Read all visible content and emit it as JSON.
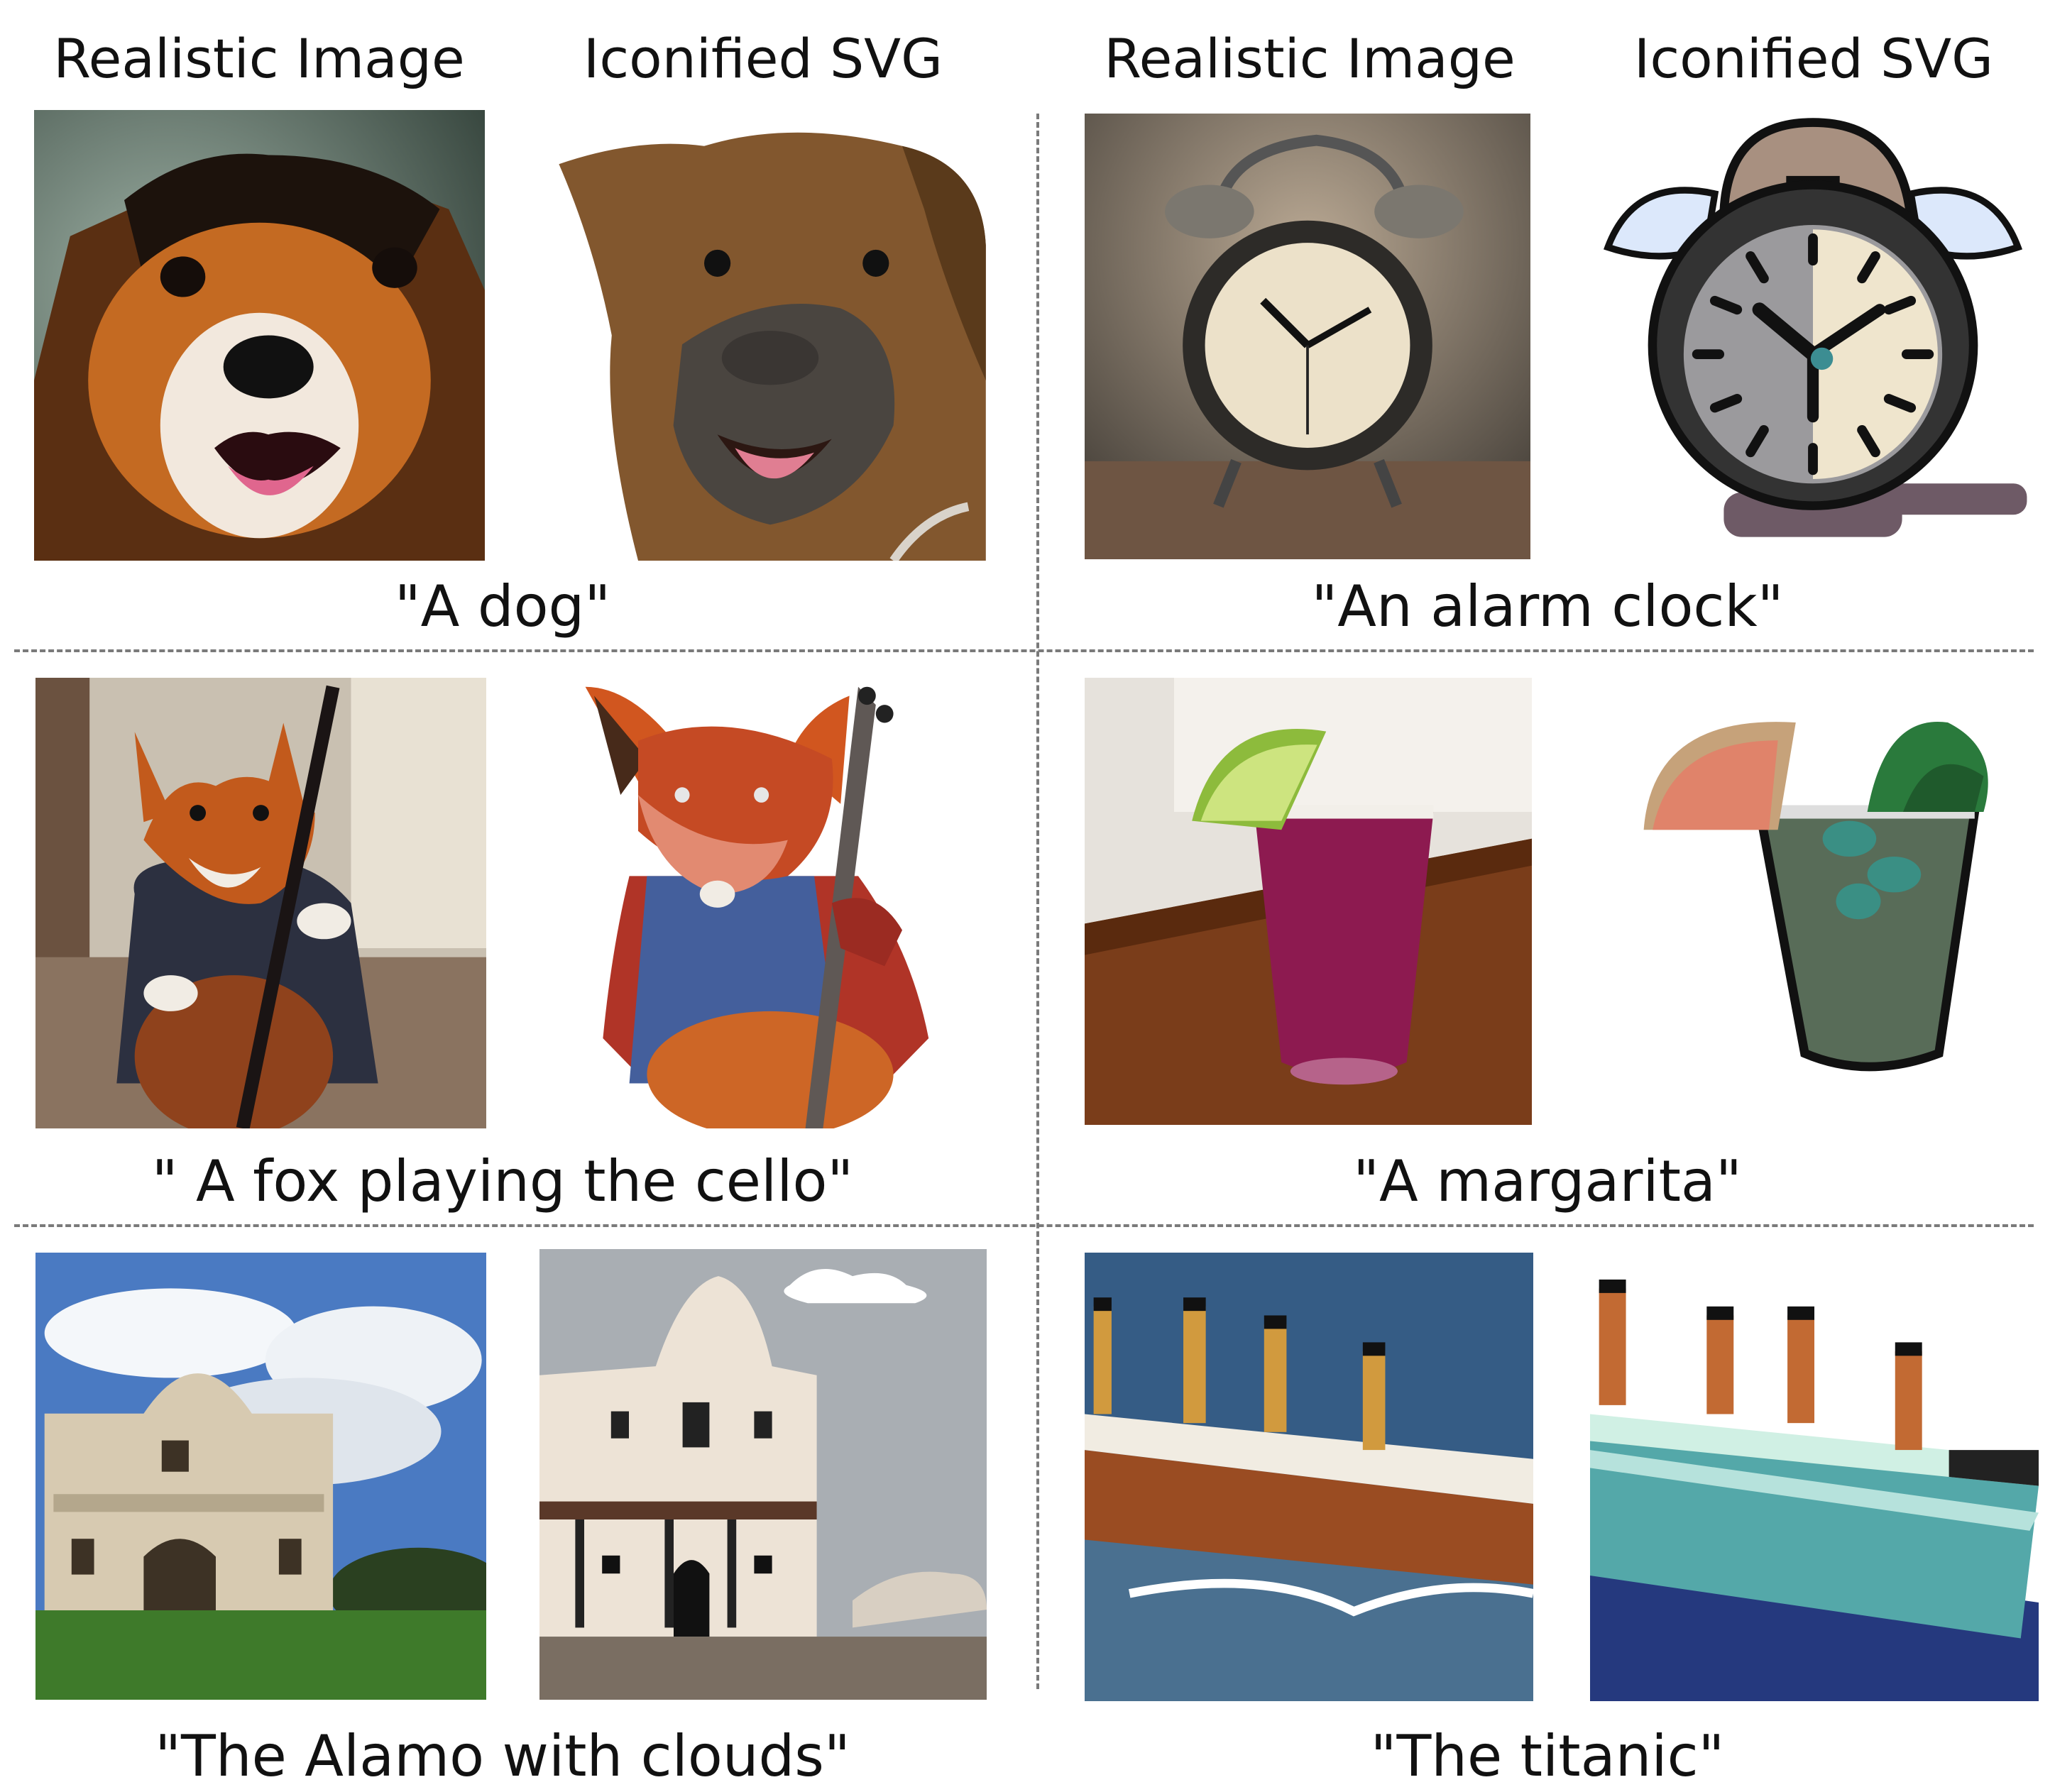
{
  "headers": {
    "left_realistic": "Realistic Image",
    "left_iconified": "Iconified SVG",
    "right_realistic": "Realistic Image",
    "right_iconified": "Iconified SVG"
  },
  "examples": [
    {
      "caption": "\"A dog\""
    },
    {
      "caption": "\"An alarm clock\""
    },
    {
      "caption": "\" A fox playing the cello\""
    },
    {
      "caption": "\"A margarita\""
    },
    {
      "caption": "\"The Alamo with clouds\""
    },
    {
      "caption": "\"The titanic\""
    }
  ]
}
